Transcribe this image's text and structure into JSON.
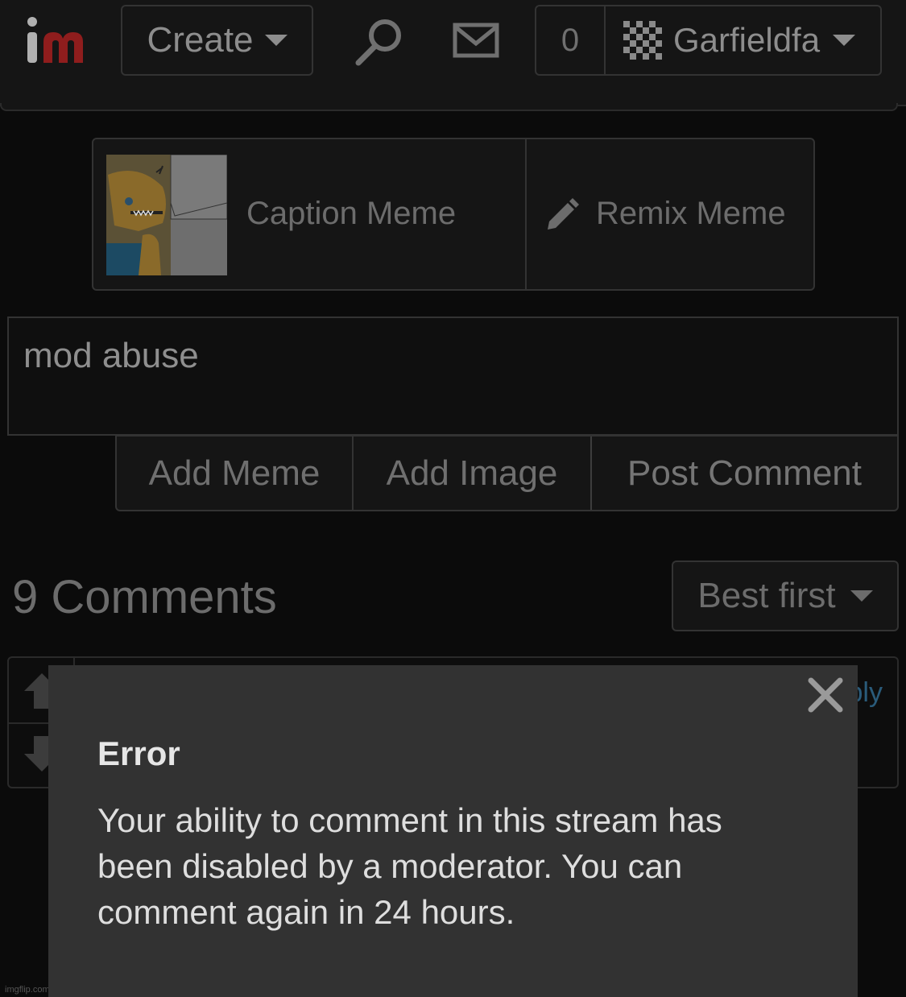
{
  "header": {
    "logo_text": "im",
    "create_label": "Create",
    "notification_count": "0",
    "username": "Garfieldfan"
  },
  "meme_actions": {
    "caption_label": "Caption Meme",
    "remix_label": "Remix Meme"
  },
  "comment_form": {
    "text": "mod abuse",
    "add_meme_label": "Add Meme",
    "add_image_label": "Add Image",
    "post_label": "Post Comment"
  },
  "comments": {
    "title": "9 Comments",
    "sort_label": "Best first",
    "reply_label": "Reply"
  },
  "modal": {
    "title": "Error",
    "message": "Your ability to comment in this stream has been disabled by a moderator. You can comment again in 24 hours."
  },
  "watermark": "imgflip.com",
  "colors": {
    "background": "#0b0b0b",
    "modal_background": "#323232",
    "logo_accent": "#8f1d1d",
    "link": "#2a5b7a"
  }
}
